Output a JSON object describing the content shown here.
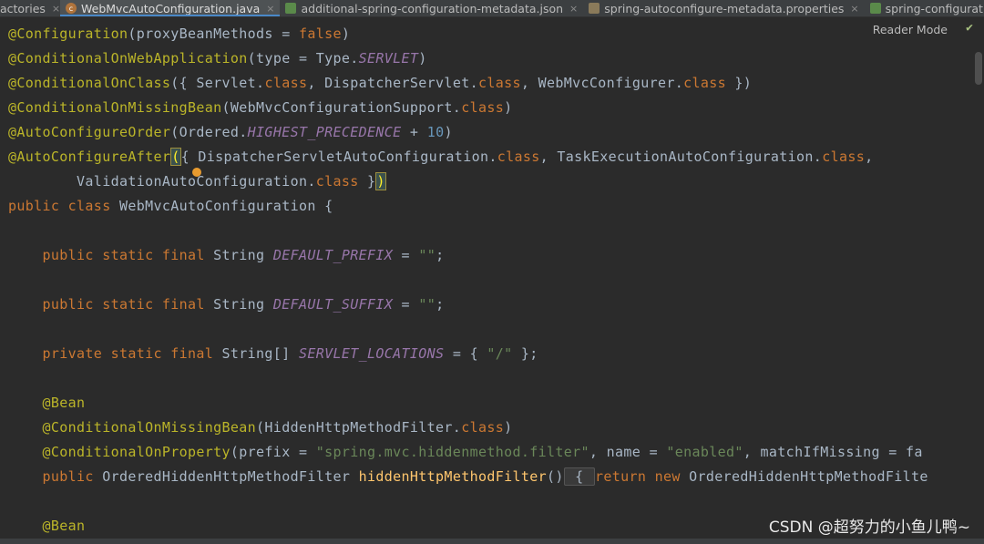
{
  "tabs": [
    {
      "label": "actories",
      "icon": "factories-file-icon"
    },
    {
      "label": "WebMvcAutoConfiguration.java",
      "icon": "java-class-icon",
      "active": true
    },
    {
      "label": "additional-spring-configuration-metadata.json",
      "icon": "json-file-icon"
    },
    {
      "label": "spring-autoconfigure-metadata.properties",
      "icon": "properties-file-icon"
    },
    {
      "label": "spring-configurati",
      "icon": "json-file-icon"
    }
  ],
  "editor": {
    "reader_mode": "Reader Mode",
    "lines": [
      [
        "@Configuration",
        "(proxyBeanMethods = ",
        "false",
        ")"
      ],
      [
        "@ConditionalOnWebApplication",
        "(type = Type.",
        "SERVLET",
        ")"
      ],
      [
        "@ConditionalOnClass",
        "({ Servlet.",
        "class",
        ", DispatcherServlet.",
        "class",
        ", WebMvcConfigurer.",
        "class",
        " })"
      ],
      [
        "@ConditionalOnMissingBean",
        "(WebMvcConfigurationSupport.",
        "class",
        ")"
      ],
      [
        "@AutoConfigureOrder",
        "(Ordered.",
        "HIGHEST_PRECEDENCE",
        " + ",
        "10",
        ")"
      ],
      [
        "@AutoConfigureAfter",
        "(",
        "{ DispatcherServletAutoConfiguration.",
        "class",
        ", TaskExecutionAutoConfiguration.",
        "class",
        ","
      ],
      [
        "        ValidationAutoConfiguration.",
        "class",
        " }",
        ")"
      ],
      [
        "public class",
        " WebMvcAutoConfiguration {"
      ],
      [
        ""
      ],
      [
        "    public static final",
        " String ",
        "DEFAULT_PREFIX",
        " = ",
        "\"\"",
        ";"
      ],
      [
        ""
      ],
      [
        "    public static final",
        " String ",
        "DEFAULT_SUFFIX",
        " = ",
        "\"\"",
        ";"
      ],
      [
        ""
      ],
      [
        "    private static final",
        " String[] ",
        "SERVLET_LOCATIONS",
        " = { ",
        "\"/\"",
        " };"
      ],
      [
        ""
      ],
      [
        "    @Bean"
      ],
      [
        "    @ConditionalOnMissingBean",
        "(HiddenHttpMethodFilter.",
        "class",
        ")"
      ],
      [
        "    @ConditionalOnProperty",
        "(prefix = ",
        "\"spring.mvc.hiddenmethod.filter\"",
        ", name = ",
        "\"enabled\"",
        ", matchIfMissing = fa"
      ],
      [
        "    public",
        " OrderedHiddenHttpMethodFilter ",
        "hiddenHttpMethodFilter",
        "()",
        " { ",
        "return new",
        " OrderedHiddenHttpMethodFilte"
      ],
      [
        ""
      ],
      [
        "    @Bean"
      ]
    ]
  },
  "watermark": "CSDN @超努力的小鱼儿鸭~"
}
